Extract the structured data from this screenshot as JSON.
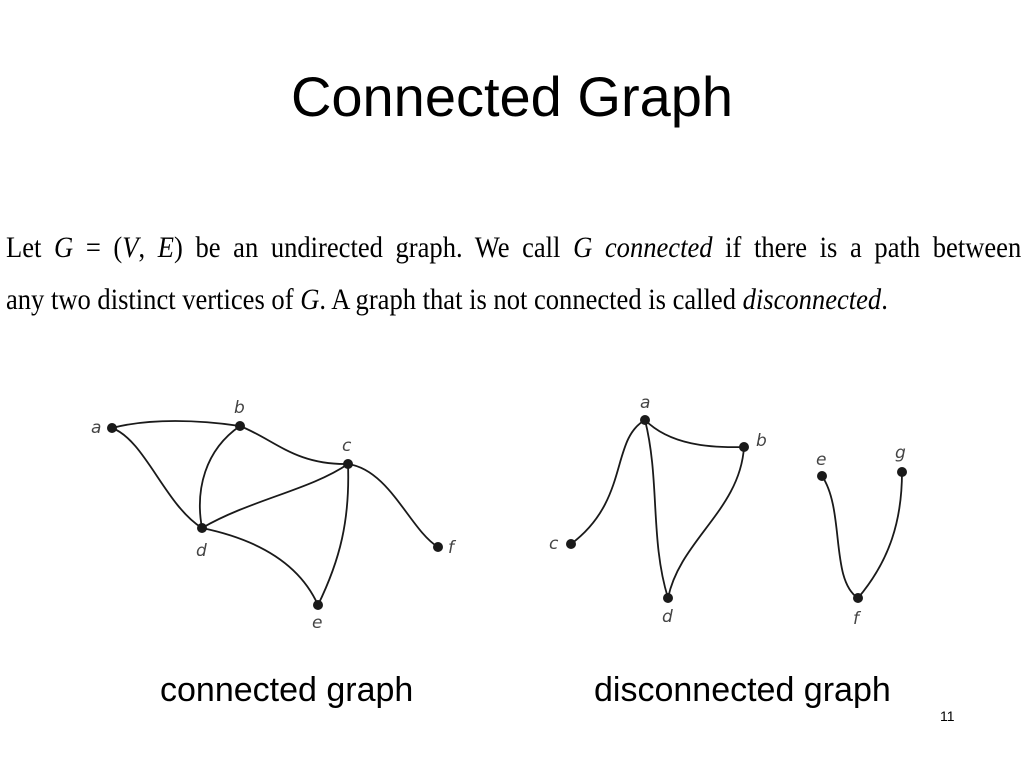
{
  "slide": {
    "title": "Connected Graph",
    "page_number": "11"
  },
  "definition": {
    "line1": [
      "Let ",
      "G",
      " = (",
      "V",
      ", ",
      "E",
      ") be an undirected graph. We call ",
      "G",
      " ",
      "connected",
      " if there is a path between"
    ],
    "line2": [
      "any two distinct vertices of ",
      "G",
      ".  A graph that is not connected is called ",
      "disconnected",
      "."
    ]
  },
  "graph_connected": {
    "caption": "connected graph",
    "vertices": [
      "a",
      "b",
      "c",
      "d",
      "e",
      "f"
    ],
    "edges": [
      [
        "a",
        "b"
      ],
      [
        "a",
        "d"
      ],
      [
        "b",
        "d"
      ],
      [
        "b",
        "c"
      ],
      [
        "c",
        "d"
      ],
      [
        "c",
        "e"
      ],
      [
        "d",
        "e"
      ],
      [
        "c",
        "f"
      ]
    ]
  },
  "graph_disconnected": {
    "caption": "disconnected graph",
    "vertices": [
      "a",
      "b",
      "c",
      "d",
      "e",
      "f",
      "g"
    ],
    "edges": [
      [
        "a",
        "c"
      ],
      [
        "a",
        "b"
      ],
      [
        "a",
        "d"
      ],
      [
        "b",
        "d"
      ],
      [
        "e",
        "f"
      ],
      [
        "f",
        "g"
      ]
    ]
  }
}
